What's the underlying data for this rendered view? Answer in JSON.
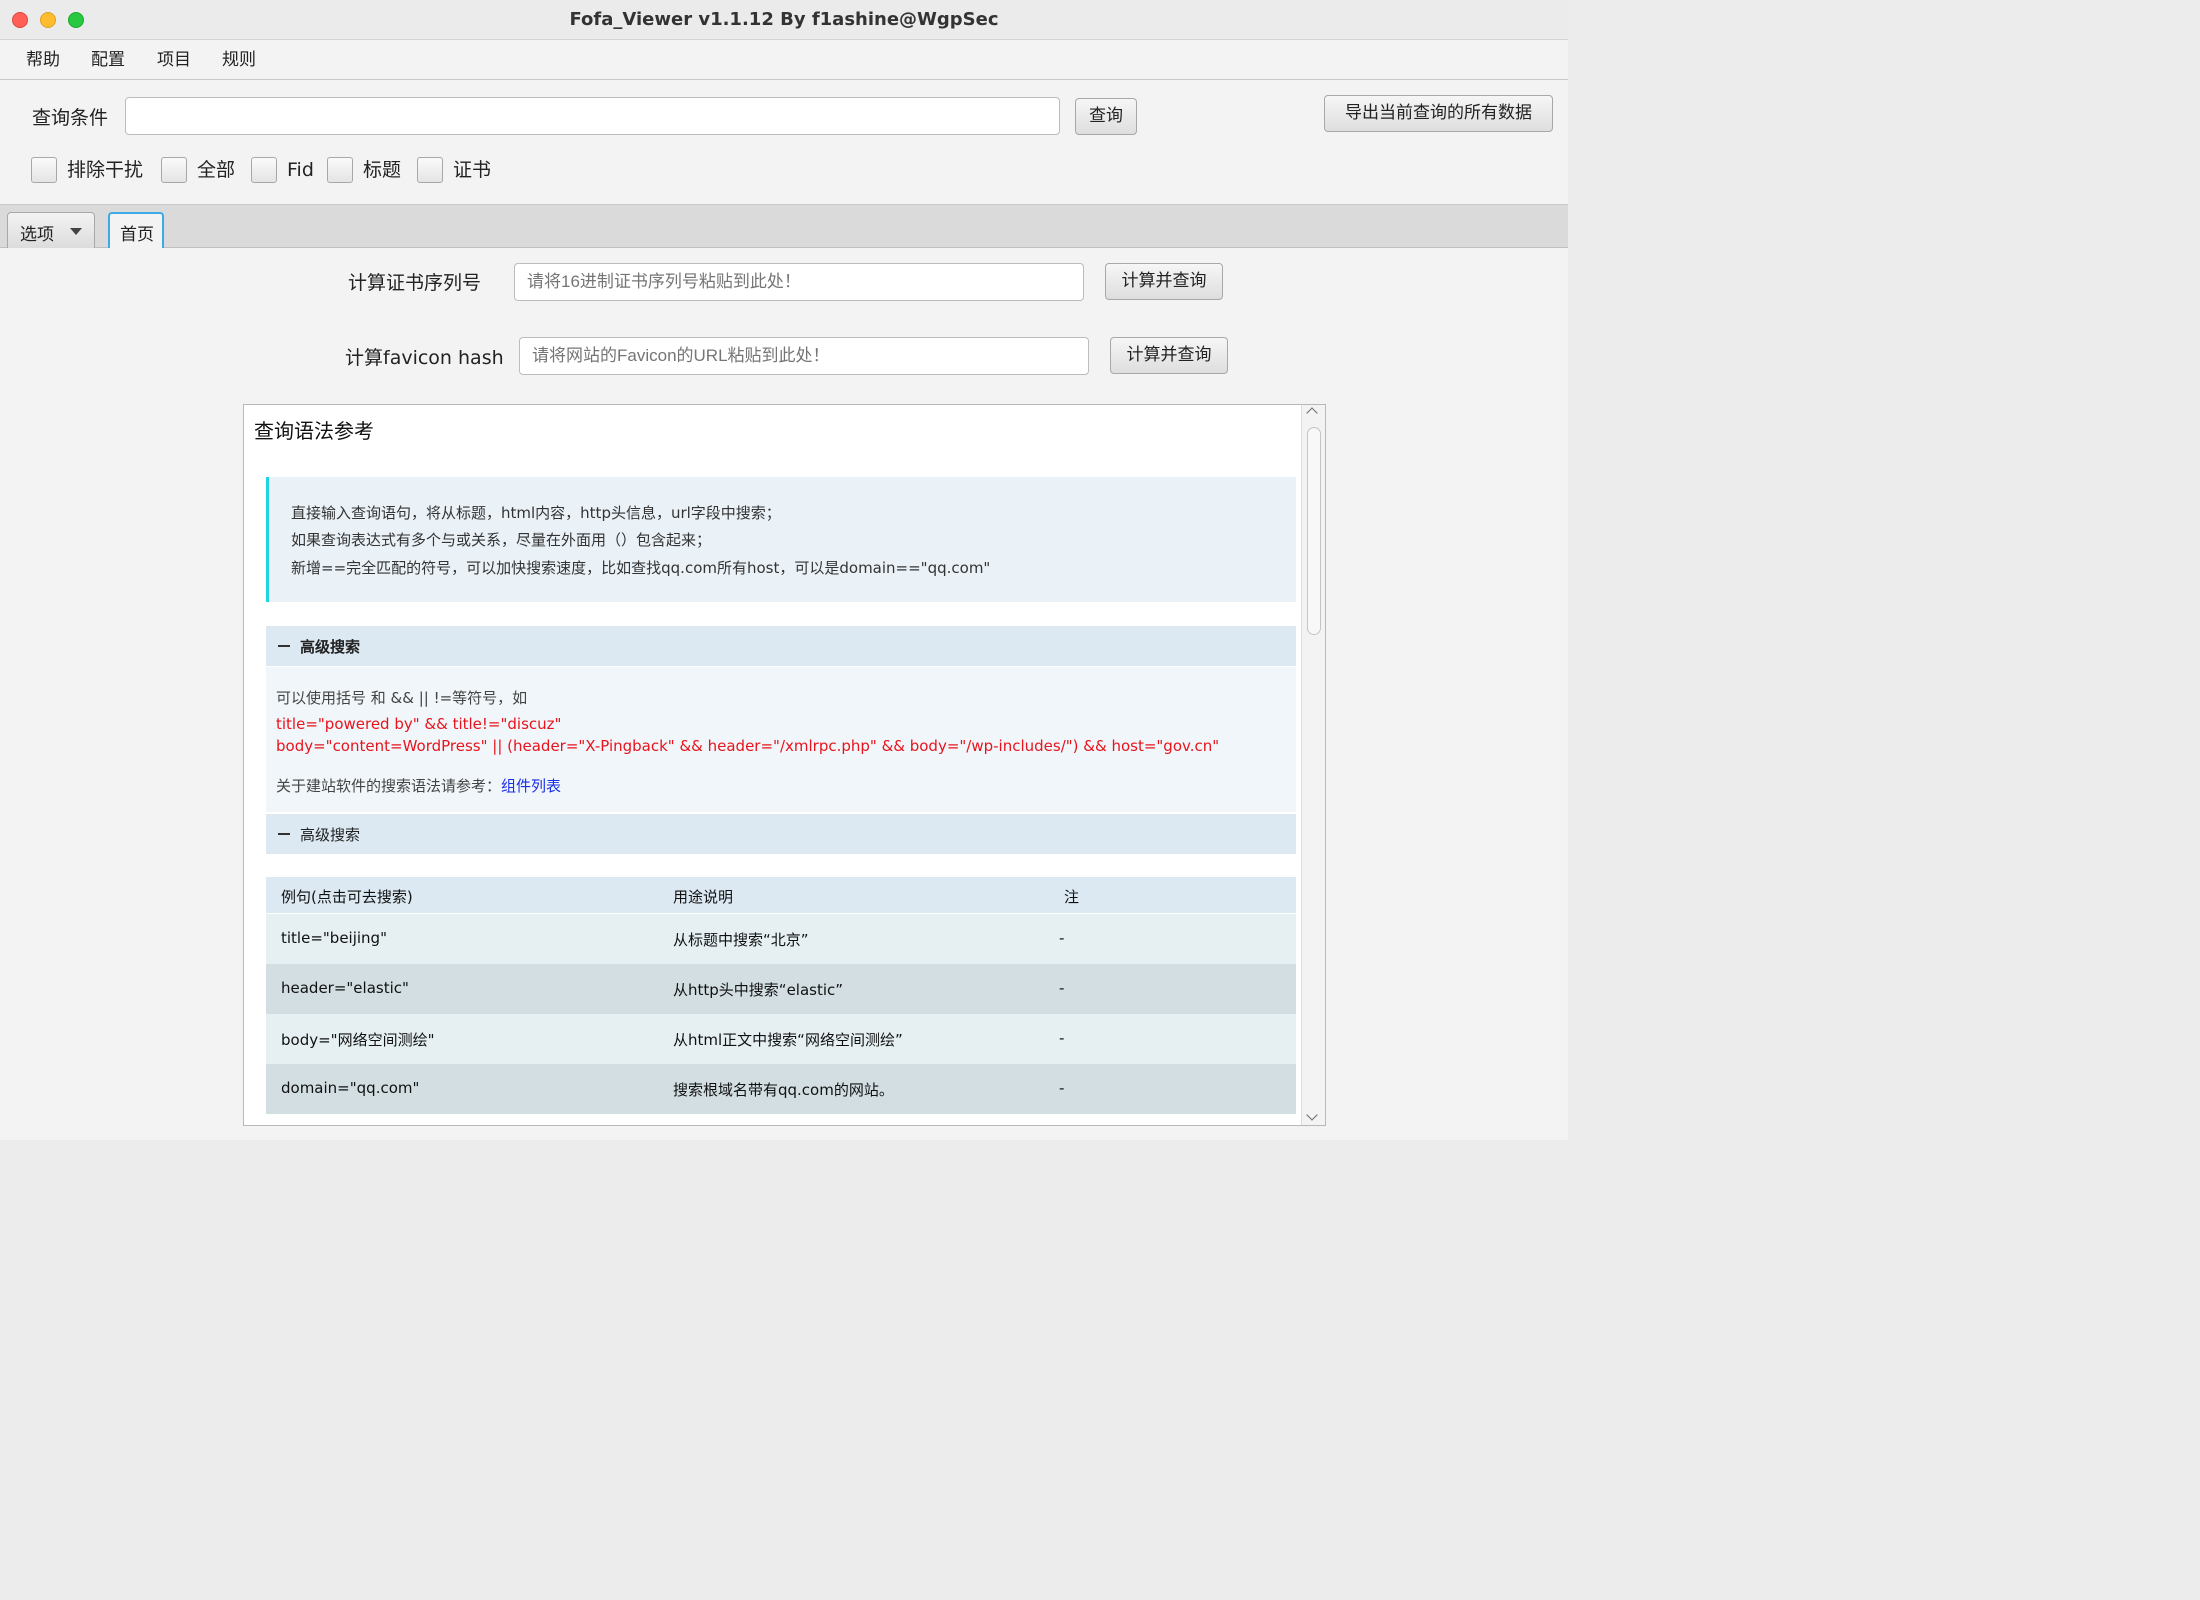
{
  "window": {
    "title": "Fofa_Viewer v1.1.12 By f1ashine@WgpSec"
  },
  "menu": [
    "帮助",
    "配置",
    "项目",
    "规则"
  ],
  "query": {
    "label": "查询条件",
    "value": "",
    "placeholder": "",
    "search_button": "查询",
    "export_button": "导出当前查询的所有数据"
  },
  "checkboxes": [
    {
      "label": "排除干扰",
      "checked": false
    },
    {
      "label": "全部",
      "checked": false
    },
    {
      "label": "Fid",
      "checked": false
    },
    {
      "label": "标题",
      "checked": false
    },
    {
      "label": "证书",
      "checked": false
    }
  ],
  "tabs": {
    "options": "选项",
    "home": "首页"
  },
  "tools": {
    "cert": {
      "label": "计算证书序列号",
      "placeholder": "请将16进制证书序列号粘贴到此处！",
      "button": "计算并查询"
    },
    "favicon": {
      "label": "计算favicon hash",
      "placeholder": "请将网站的Favicon的URL粘贴到此处！",
      "button": "计算并查询"
    }
  },
  "reference": {
    "title": "查询语法参考",
    "notes": [
      "直接输入查询语句，将从标题，html内容，http头信息，url字段中搜索；",
      "如果查询表达式有多个与或关系，尽量在外面用（）包含起来；",
      "新增==完全匹配的符号，可以加快搜索速度，比如查找qq.com所有host，可以是domain==\"qq.com\""
    ],
    "section1": {
      "title": "高级搜索",
      "intro": "可以使用括号 和 && || !=等符号，如",
      "examples": [
        "title=\"powered by\" && title!=\"discuz\"",
        "body=\"content=WordPress\" || (header=\"X-Pingback\" && header=\"/xmlrpc.php\" && body=\"/wp-includes/\") && host=\"gov.cn\""
      ],
      "ref_text": "关于建站软件的搜索语法请参考：",
      "ref_link": "组件列表"
    },
    "section2": {
      "title": "高级搜索"
    },
    "table": {
      "headers": [
        "例句(点击可去搜索)",
        "用途说明",
        "注"
      ],
      "rows": [
        [
          "title=\"beijing\"",
          "从标题中搜索“北京”",
          "-"
        ],
        [
          "header=\"elastic\"",
          "从http头中搜索“elastic”",
          "-"
        ],
        [
          "body=\"网络空间测绘\"",
          "从html正文中搜索“网络空间测绘”",
          "-"
        ],
        [
          "domain=\"qq.com\"",
          "搜索根域名带有qq.com的网站。",
          "-"
        ]
      ]
    }
  },
  "colors": {
    "accent": "#3fa9e8",
    "note_border": "#22d3e0",
    "example_red": "#e8141d",
    "link_blue": "#1a2fe8"
  }
}
